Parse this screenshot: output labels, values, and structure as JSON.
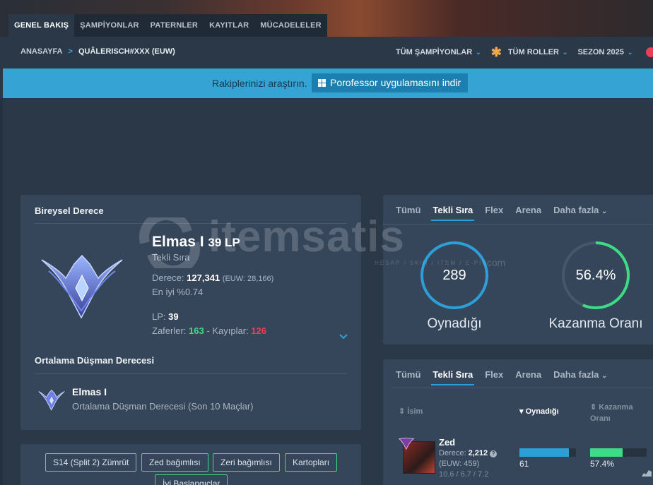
{
  "nav": {
    "tabs": [
      "GENEL BAKIŞ",
      "ŞAMPİYONLAR",
      "PATERNLER",
      "KAYITLAR",
      "MÜCADELELER"
    ],
    "active_tab": "GENEL BAKIŞ"
  },
  "breadcrumb": {
    "home": "ANASAYFA",
    "sep": ">",
    "current": "QUÂLERISCH#XXX (EUW)"
  },
  "filters": {
    "champions": "TÜM ŞAMPİYONLAR",
    "roles": "TÜM ROLLER",
    "season": "SEZON 2025"
  },
  "promo": {
    "text": "Rakiplerinizi araştırın.",
    "button": "Porofessor uygulamasını indir"
  },
  "solo_rank": {
    "title": "Bireysel Derece",
    "tier": "Elmas I",
    "lp_head": "39 LP",
    "queue": "Tekli Sıra",
    "ladder_label": "Derece:",
    "ladder_rank": "127,341",
    "ladder_region": "(EUW: 28,166)",
    "top_percent": "En iyi %0.74",
    "lp_label": "LP:",
    "lp_value": "39",
    "wins_label": "Zaferler:",
    "wins": "163",
    "dash": "-",
    "losses_label": "Kayıplar:",
    "losses": "126"
  },
  "avg_enemy": {
    "title": "Ortalama Düşman Derecesi",
    "tier": "Elmas I",
    "desc": "Ortalama Düşman Derecesi (Son 10 Maçlar)"
  },
  "queue_tabs": [
    "Tümü",
    "Tekli Sıra",
    "Flex",
    "Arena",
    "Daha fazla"
  ],
  "queue_tabs_active": "Tekli Sıra",
  "stats": {
    "played_value": "289",
    "played_label": "Oynadığı",
    "winrate_value": "56.4%",
    "winrate_fraction": 0.564,
    "winrate_label": "Kazanma Oranı"
  },
  "tags": [
    "S14 (Split 2) Zümrüt",
    "Zed bağımlısı",
    "Zeri bağımlısı",
    "Kartopları",
    "İyi Başlangıçlar"
  ],
  "champ_table": {
    "headers": {
      "name": "İsim",
      "played": "Oynadığı",
      "winrate_line1": "Kazanma",
      "winrate_line2": "Oranı"
    },
    "rows": [
      {
        "name": "Zed",
        "rank_label": "Derece:",
        "rank": "2,212",
        "region": "(EUW: 459)",
        "kda": "10.6 / 6.7 / 7.2",
        "played": "61",
        "played_fraction": 0.88,
        "winrate": "57.4%",
        "winrate_fraction": 0.574
      }
    ]
  },
  "watermark": {
    "brand": "itemsatis",
    "sub": "HESAP / SKIN / ITEM / E-PIN",
    "suffix": ".com"
  },
  "colors": {
    "accent": "#2d9fd8",
    "win": "#3ddc84",
    "loss": "#e84057",
    "promo": "#35a3d3"
  }
}
